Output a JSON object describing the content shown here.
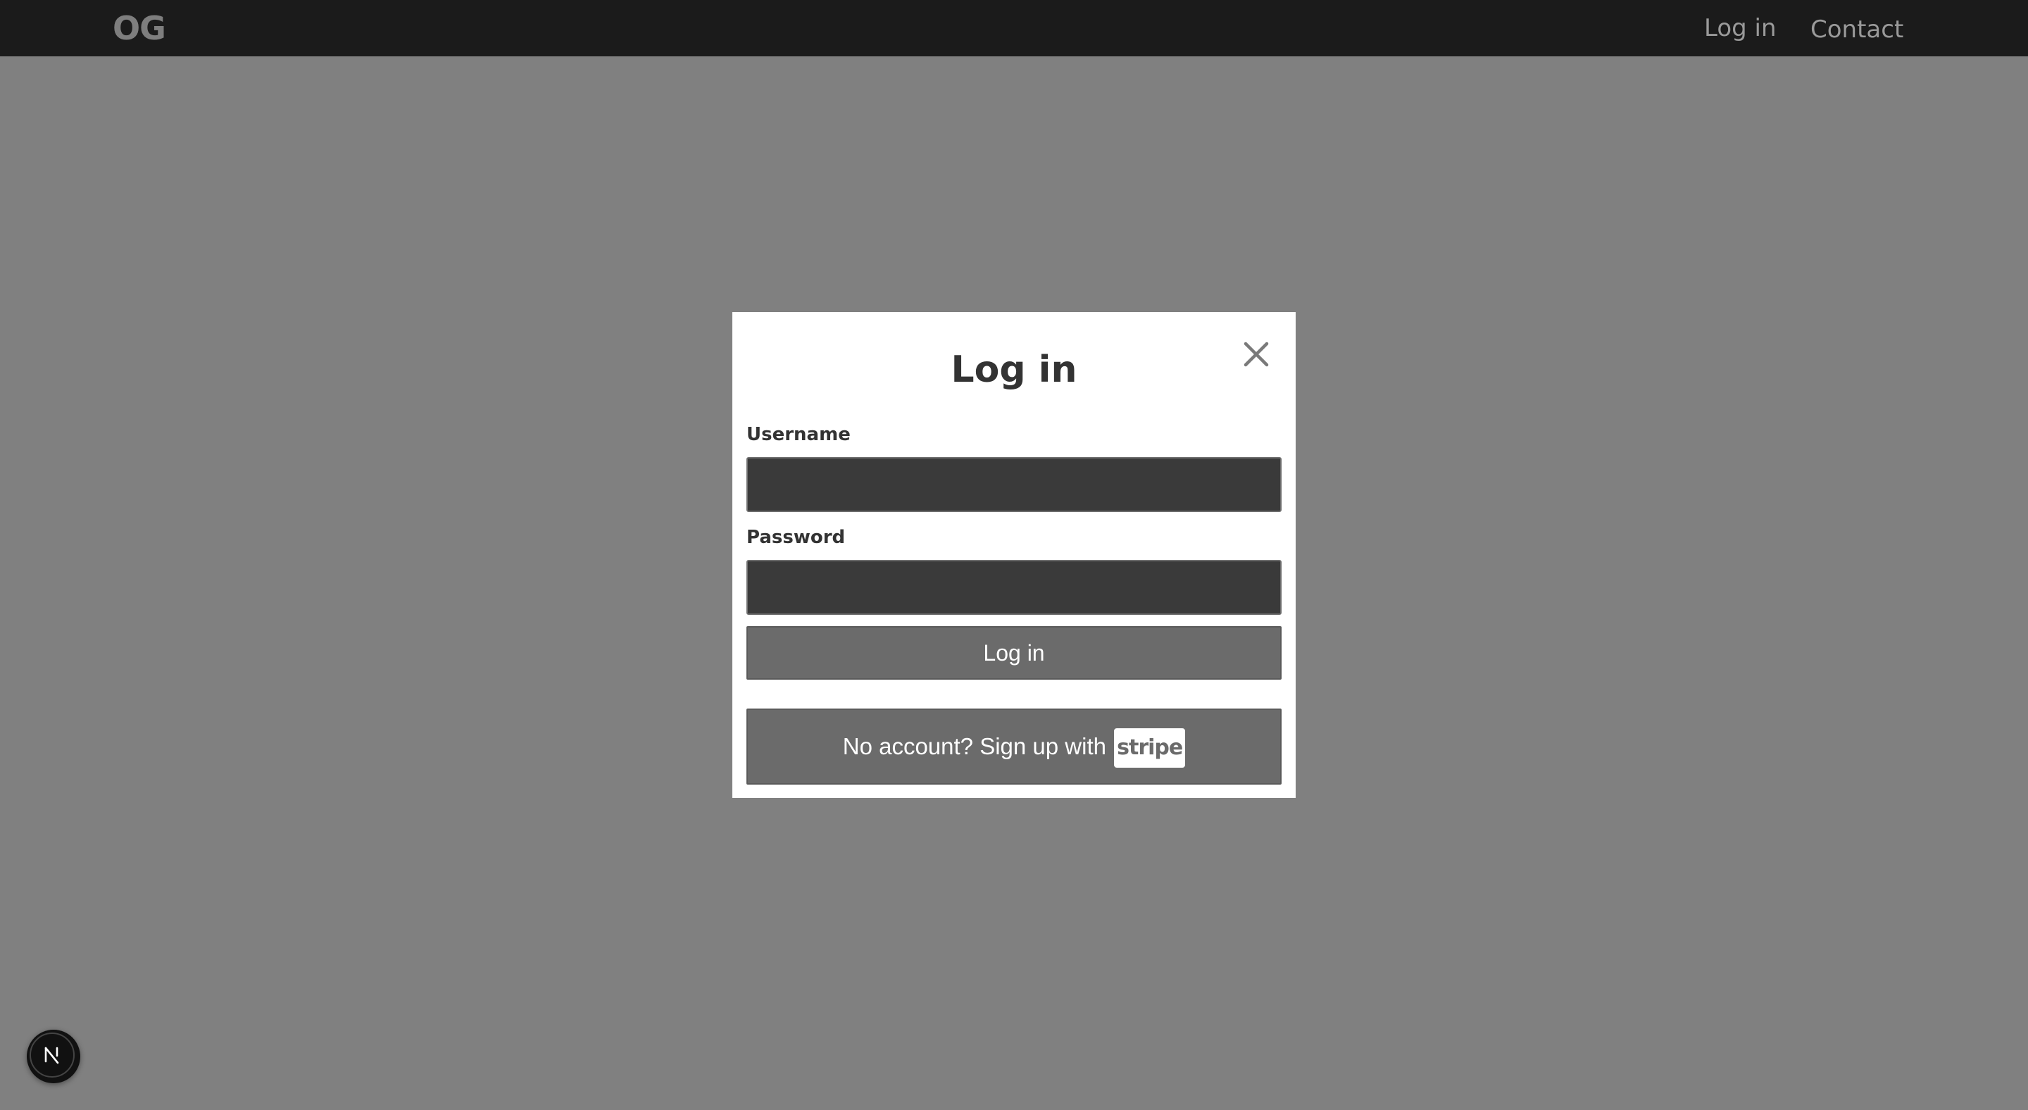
{
  "header": {
    "logo": "OG",
    "nav": {
      "login": "Log in",
      "contact": "Contact"
    }
  },
  "modal": {
    "title": "Log in",
    "close_icon": "close-icon",
    "username": {
      "label": "Username",
      "value": ""
    },
    "password": {
      "label": "Password",
      "value": ""
    },
    "login_button": "Log in",
    "signup": {
      "text": "No account? Sign up with",
      "brand": "stripe"
    }
  },
  "dev_badge": {
    "icon": "nextjs-logo-icon"
  },
  "colors": {
    "topbar": "#1b1b1b",
    "overlay": "#808080",
    "modal_bg": "#ffffff",
    "input_bg": "#3a3a3a",
    "button_bg": "#6b6b6b",
    "text_dark": "#333333"
  }
}
